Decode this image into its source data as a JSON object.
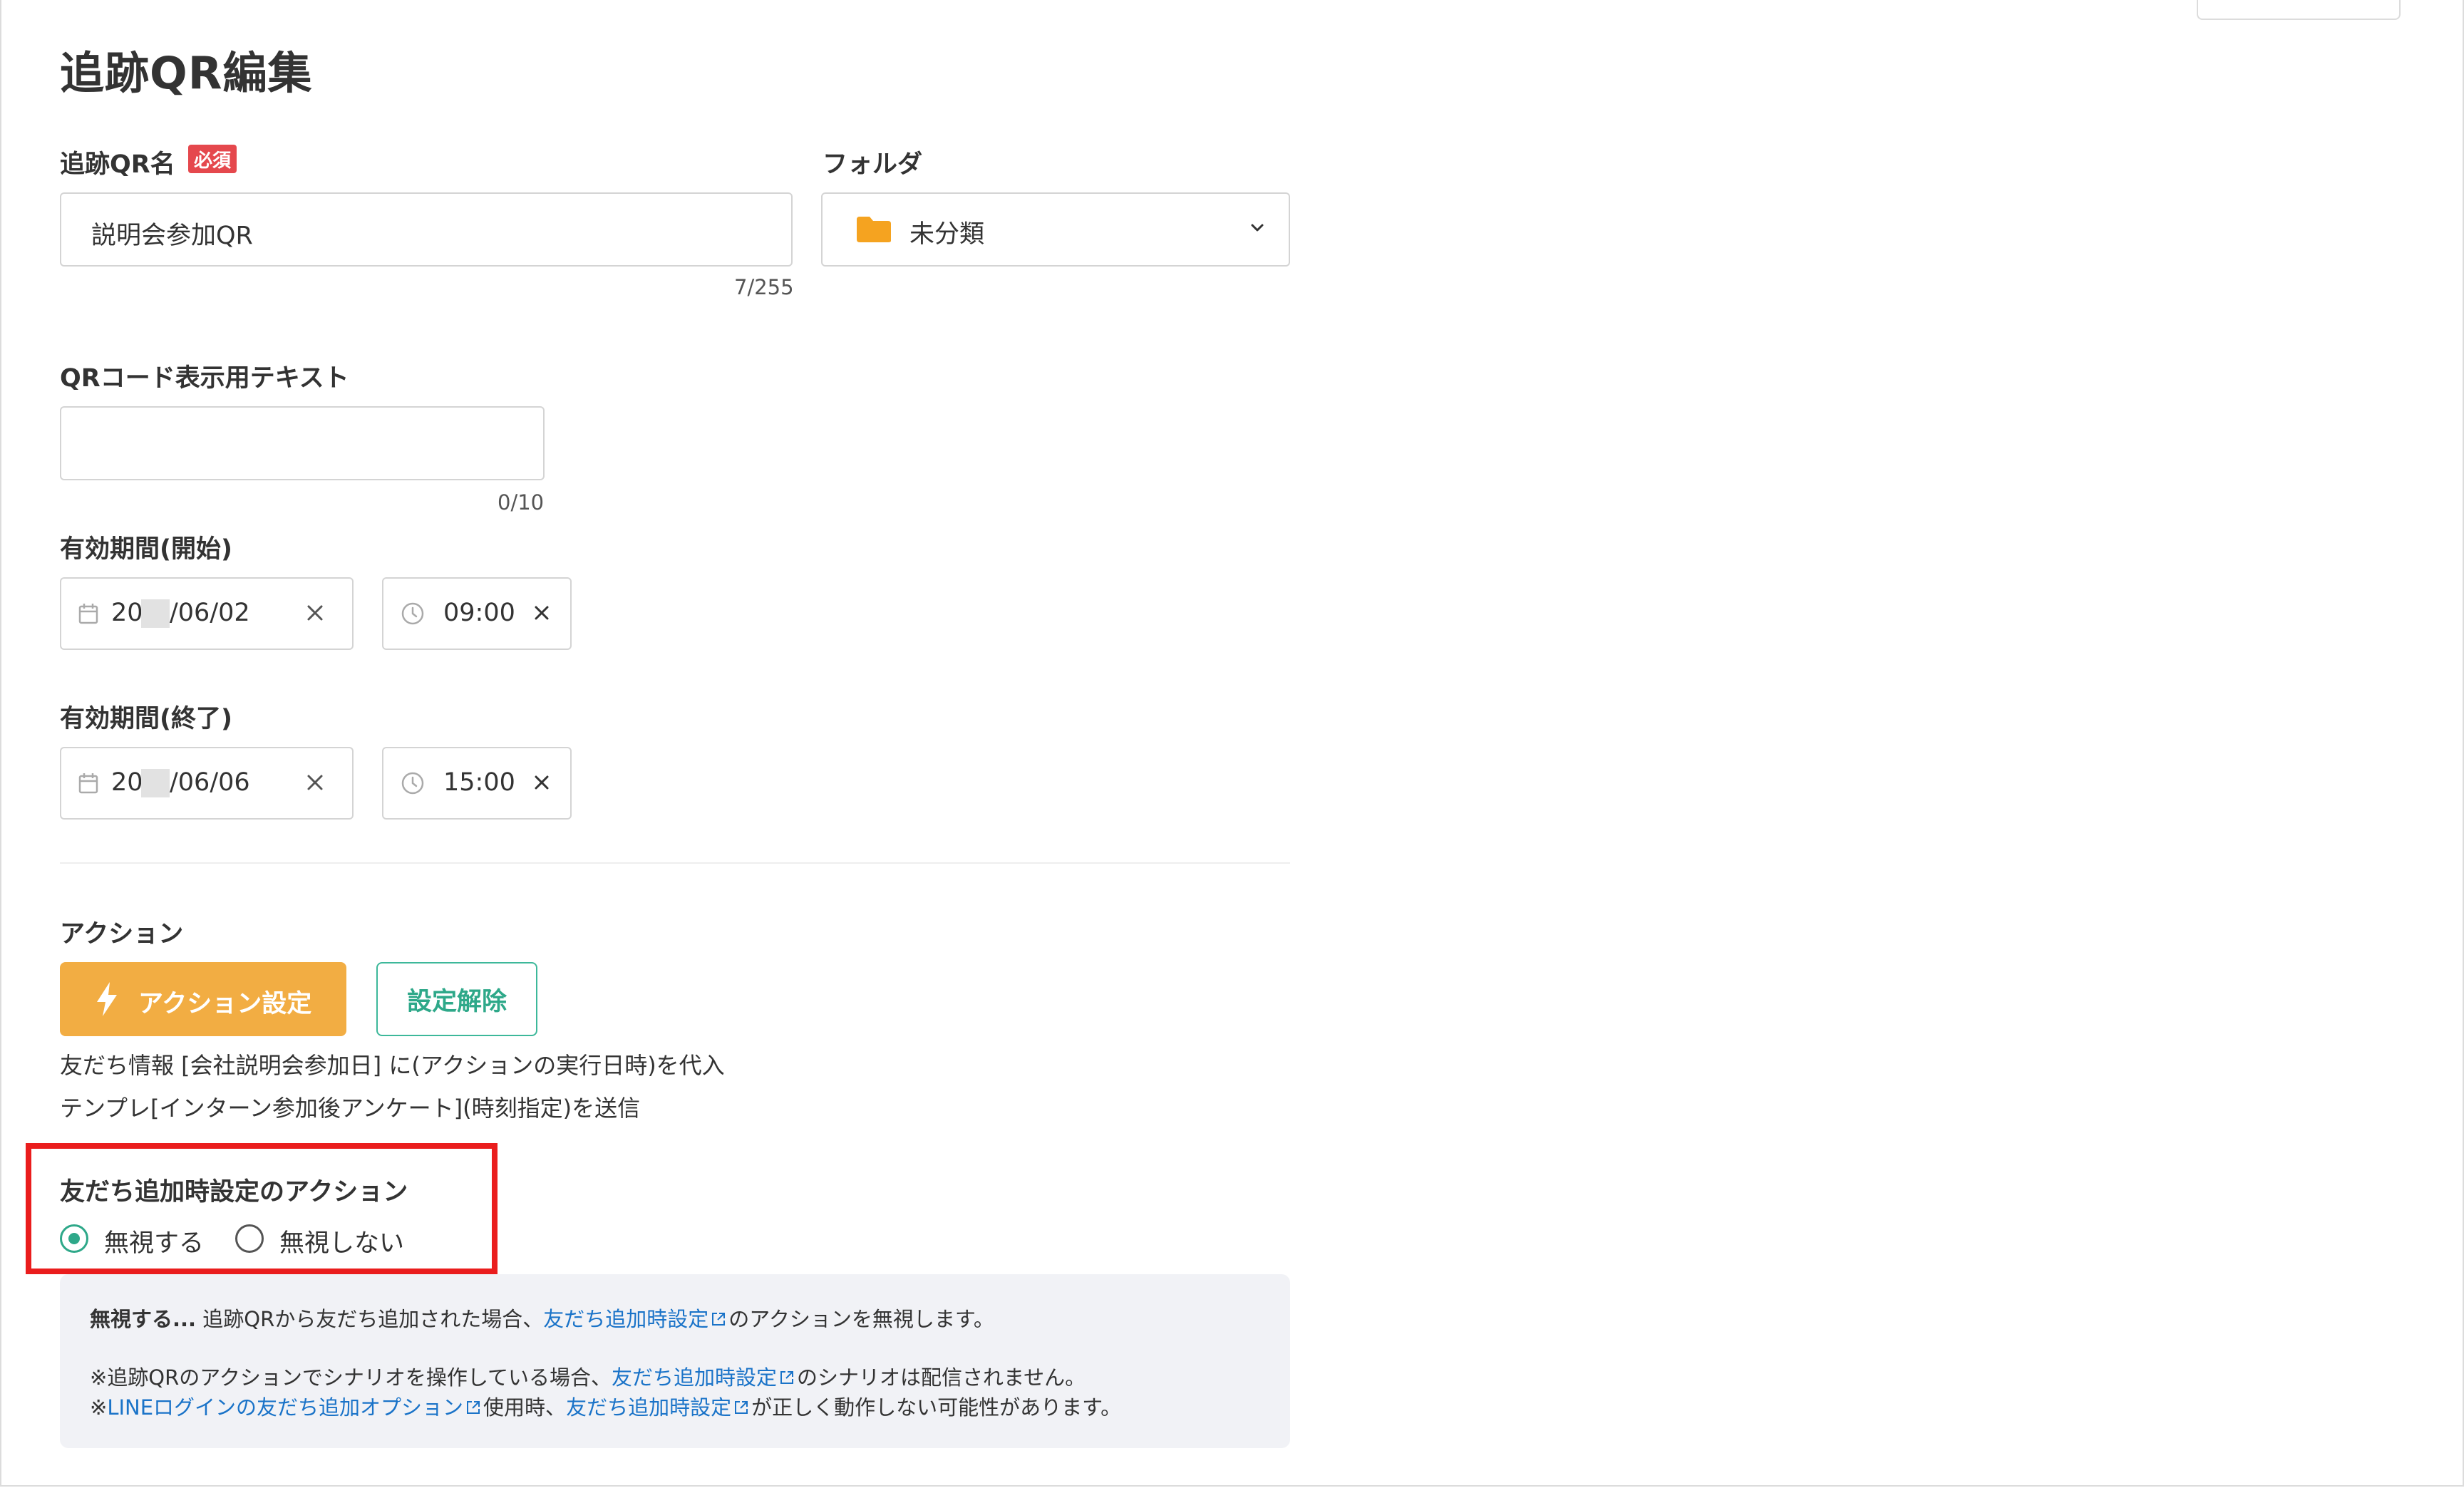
{
  "page": {
    "title": "追跡QR編集"
  },
  "name_field": {
    "label": "追跡QR名",
    "required_badge": "必須",
    "value": "説明会参加QR",
    "counter": "7/255"
  },
  "folder_field": {
    "label": "フォルダ",
    "value": "未分類",
    "icon": "folder-icon",
    "folder_color": "#f5a320"
  },
  "qr_text_field": {
    "label": "QRコード表示用テキスト",
    "value": "",
    "counter": "0/10"
  },
  "start_period": {
    "label": "有効期間(開始)",
    "date_prefix": "20",
    "date_suffix": "/06/02",
    "time": "09:00"
  },
  "end_period": {
    "label": "有効期間(終了)",
    "date_prefix": "20",
    "date_suffix": "/06/06",
    "time": "15:00"
  },
  "action": {
    "label": "アクション",
    "set_button": "アクション設定",
    "clear_button": "設定解除",
    "descriptions": [
      "友だち情報 [会社説明会参加日] に(アクションの実行日時)を代入",
      "テンプレ[インターン参加後アンケート](時刻指定)を送信"
    ]
  },
  "friend_add_action": {
    "label": "友だち追加時設定のアクション",
    "options": [
      {
        "label": "無視する",
        "checked": true
      },
      {
        "label": "無視しない",
        "checked": false
      }
    ]
  },
  "info": {
    "line1": {
      "bold": "無視する...",
      "text_a": " 追跡QRから友だち追加された場合、",
      "link": "友だち追加時設定",
      "text_b": "のアクションを無視します。"
    },
    "line2": {
      "text_a": "※追跡QRのアクションでシナリオを操作している場合、",
      "link": "友だち追加時設定",
      "text_b": "のシナリオは配信されません。"
    },
    "line3": {
      "text_a": "※",
      "link_a": "LINEログインの友だち追加オプション",
      "text_b": "使用時、",
      "link_b": "友だち追加時設定",
      "text_c": "が正しく動作しない可能性があります。"
    }
  },
  "colors": {
    "primary": "#f2ad43",
    "accent_green": "#2ea889",
    "required_red": "#e5484d",
    "link_blue": "#1a73c8",
    "highlight_red": "#ea1d1d"
  }
}
